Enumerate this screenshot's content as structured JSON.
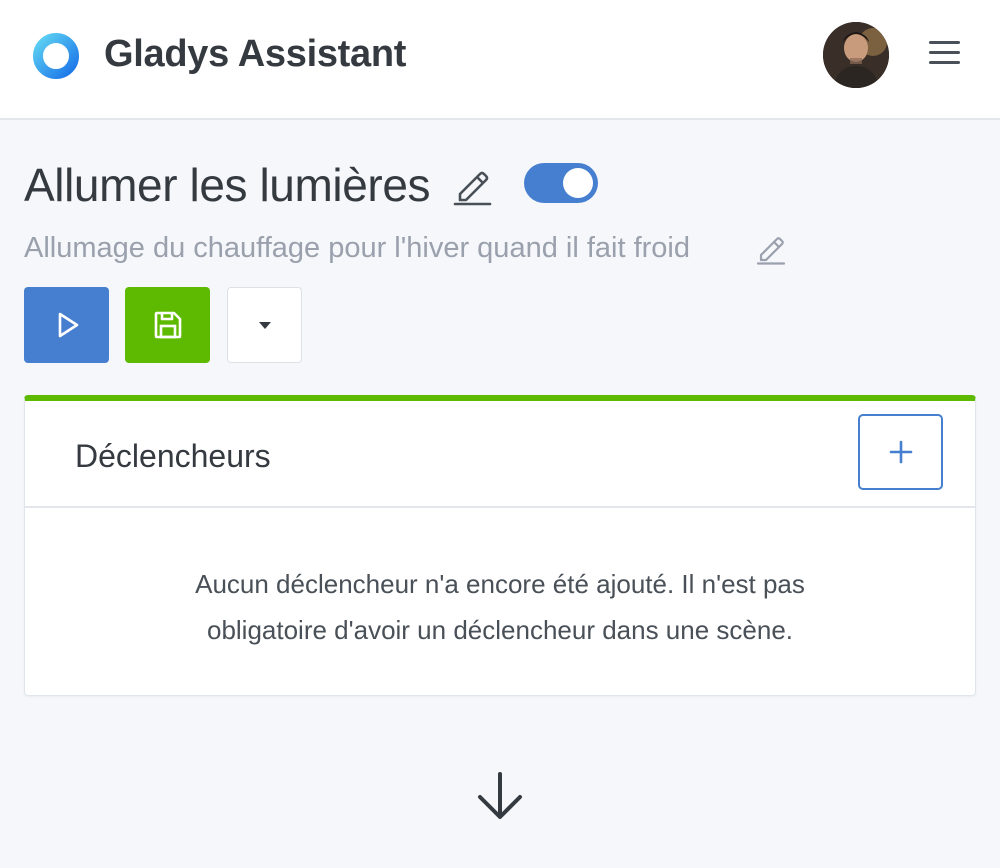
{
  "header": {
    "app_title": "Gladys Assistant",
    "icons": {
      "logo": "gladys-logo-icon",
      "avatar": "user-avatar",
      "menu": "hamburger-menu-icon"
    }
  },
  "scene": {
    "title": "Allumer les lumières",
    "description": "Allumage du chauffage pour l'hiver quand il fait froid",
    "active": true
  },
  "toolbar": {
    "icons": {
      "start": "play-icon",
      "save": "save-icon",
      "more": "caret-down-icon"
    }
  },
  "triggers": {
    "title": "Déclencheurs",
    "empty_line_1": "Aucun déclencheur n'a encore été ajouté. Il n'est pas",
    "empty_line_2": "obligatoire d'avoir un déclencheur dans une scène."
  },
  "colors": {
    "primary": "#467fcf",
    "success": "#5eba00",
    "background": "#f5f7fb",
    "muted_text": "#9aa0ac"
  }
}
